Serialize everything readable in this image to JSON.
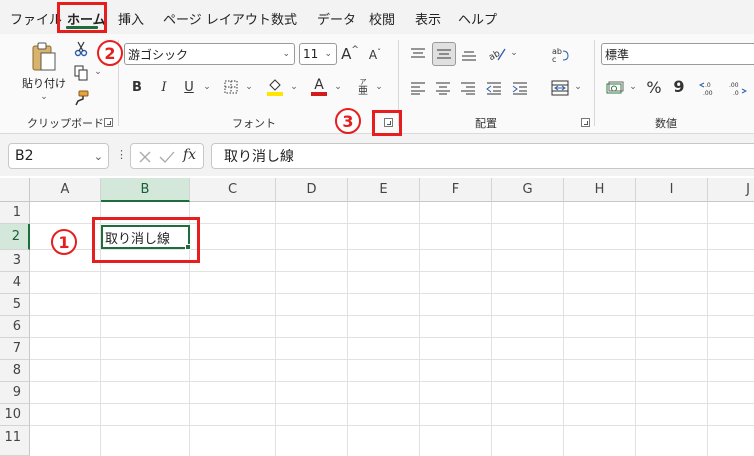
{
  "menu": {
    "tabs": [
      "ファイル",
      "ホーム",
      "挿入",
      "ページ レイアウト",
      "数式",
      "データ",
      "校閲",
      "表示",
      "ヘルプ"
    ]
  },
  "ribbon": {
    "clipboard": {
      "paste_label": "貼り付け",
      "group_label": "クリップボード"
    },
    "font": {
      "font_name": "游ゴシック",
      "font_size": "11",
      "group_label": "フォント",
      "bold": "B",
      "italic": "I",
      "underline": "U",
      "grow": "A",
      "shrink": "A",
      "phonetic": "亜"
    },
    "alignment": {
      "group_label": "配置"
    },
    "number": {
      "format": "標準",
      "group_label": "数値",
      "percent": "%",
      "comma": "9"
    }
  },
  "formula_bar": {
    "name_box": "B2",
    "fx": "fx",
    "content": "取り消し線"
  },
  "grid": {
    "columns": [
      "A",
      "B",
      "C",
      "D",
      "E",
      "F",
      "G",
      "H",
      "I",
      "J"
    ],
    "rows": [
      "1",
      "2",
      "3",
      "4",
      "5",
      "6",
      "7",
      "8",
      "9",
      "10",
      "11"
    ],
    "active_cell_text": "取り消し線"
  },
  "annotations": {
    "n1": "1",
    "n2": "2",
    "n3": "3"
  },
  "colors": {
    "accent": "#1e6e3c",
    "annotation": "#e61e1e"
  }
}
